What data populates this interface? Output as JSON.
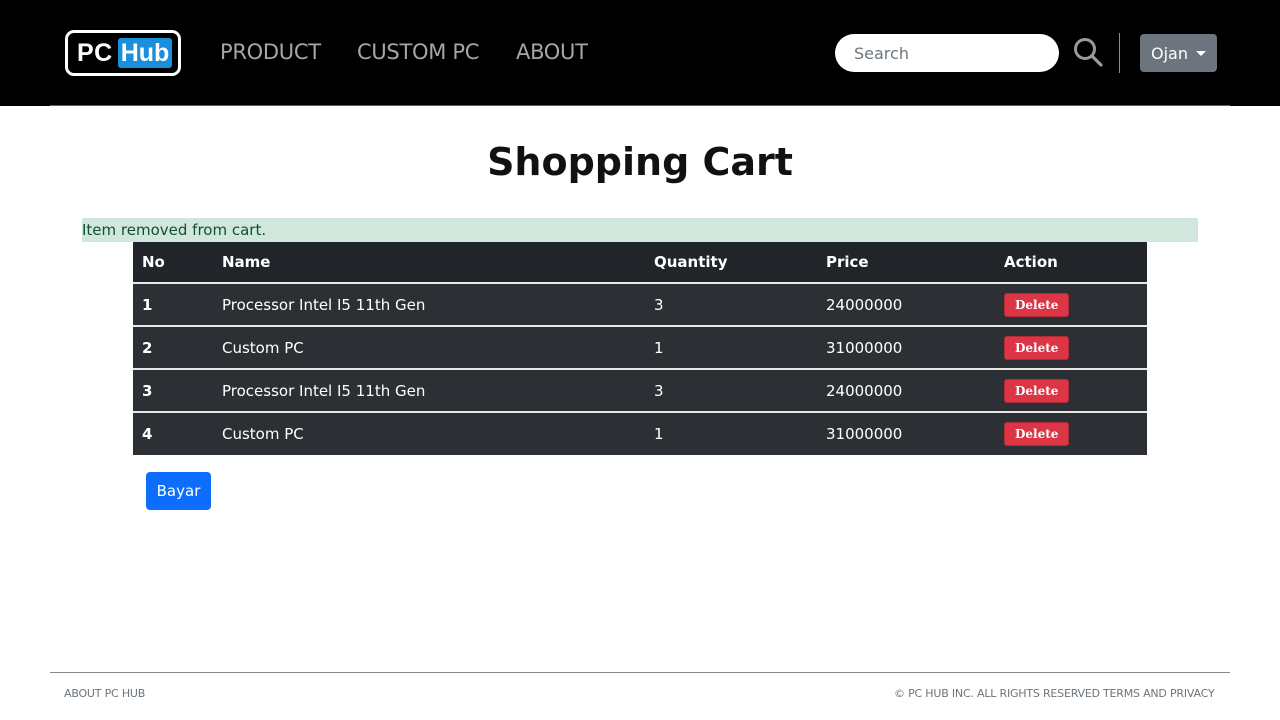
{
  "navbar": {
    "logo": {
      "pc": "PC",
      "hub": "Hub"
    },
    "links": [
      "PRODUCT",
      "CUSTOM PC",
      "ABOUT"
    ],
    "search_placeholder": "Search",
    "user_label": "Ojan"
  },
  "page": {
    "title": "Shopping Cart",
    "alert": "Item removed from cart."
  },
  "table": {
    "headers": [
      "No",
      "Name",
      "Quantity",
      "Price",
      "Action"
    ],
    "rows": [
      {
        "no": "1",
        "name": "Processor Intel I5 11th Gen",
        "quantity": "3",
        "price": "24000000",
        "action": "Delete"
      },
      {
        "no": "2",
        "name": "Custom PC",
        "quantity": "1",
        "price": "31000000",
        "action": "Delete"
      },
      {
        "no": "3",
        "name": "Processor Intel I5 11th Gen",
        "quantity": "3",
        "price": "24000000",
        "action": "Delete"
      },
      {
        "no": "4",
        "name": "Custom PC",
        "quantity": "1",
        "price": "31000000",
        "action": "Delete"
      }
    ]
  },
  "pay_button": "Bayar",
  "footer": {
    "about": "ABOUT PC HUB",
    "copyright": "© PC HUB INC. ALL RIGHTS RESERVED",
    "terms": "TERMS AND PRIVACY"
  },
  "colors": {
    "navbar_bg": "#000000",
    "accent_blue": "#0d6efd",
    "logo_blue": "#1a8fdc",
    "delete_red": "#dc3545",
    "alert_bg": "#d1e7dd",
    "table_dark": "#212529"
  }
}
